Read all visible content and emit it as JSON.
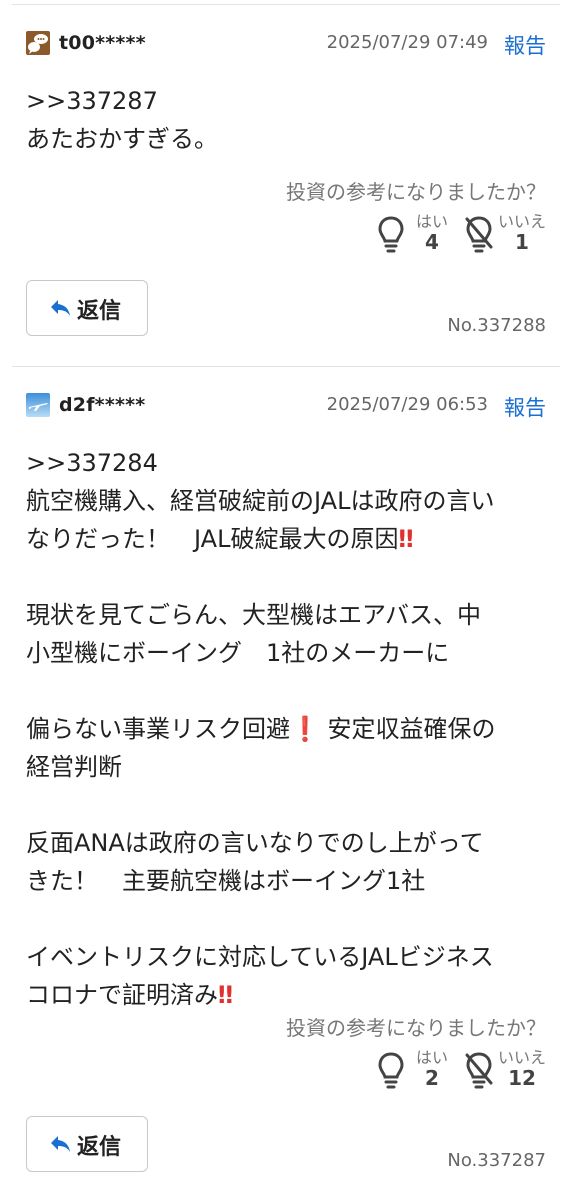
{
  "vote_question": "投資の参考になりましたか？",
  "vote_yes_label": "はい",
  "vote_no_label": "いいえ",
  "reply_label": "返信",
  "report_label": "報告",
  "posts": [
    {
      "username": "t00*****",
      "avatar_icon": "chat-bubble-avatar-icon",
      "timestamp": "2025/07/29 07:49",
      "body": {
        "line1": ">>337287",
        "line2": "あたおかすぎる。"
      },
      "votes_yes": "4",
      "votes_no": "1",
      "post_number": "No.337288"
    },
    {
      "username": "d2f*****",
      "avatar_icon": "airplane-sky-avatar-icon",
      "timestamp": "2025/07/29 06:53",
      "body": {
        "line1": ">>337284",
        "line2": "航空機購入、経営破綻前のJALは政府の言い",
        "line3": "なりだった！　JAL破綻最大の原因",
        "line3_emoji": "‼",
        "line4": "現状を見てごらん、大型機はエアバス、中",
        "line5": "小型機にボーイング　1社のメーカーに",
        "line6": "偏らない事業リスク回避",
        "line6_emoji": "❗",
        "line6_rest": " 安定収益確保の",
        "line7": "経営判断",
        "line8": "反面ANAは政府の言いなりでのし上がって",
        "line9": "きた！　主要航空機はボーイング1社",
        "line10": "イベントリスクに対応しているJALビジネス",
        "line11": "コロナで証明済み",
        "line11_emoji": "‼"
      },
      "votes_yes": "2",
      "votes_no": "12",
      "post_number": "No.337287"
    }
  ],
  "colors": {
    "link": "#1a6fd0",
    "muted": "#777777",
    "divider": "#e3e3e3",
    "emoji_red": "#e03030"
  }
}
